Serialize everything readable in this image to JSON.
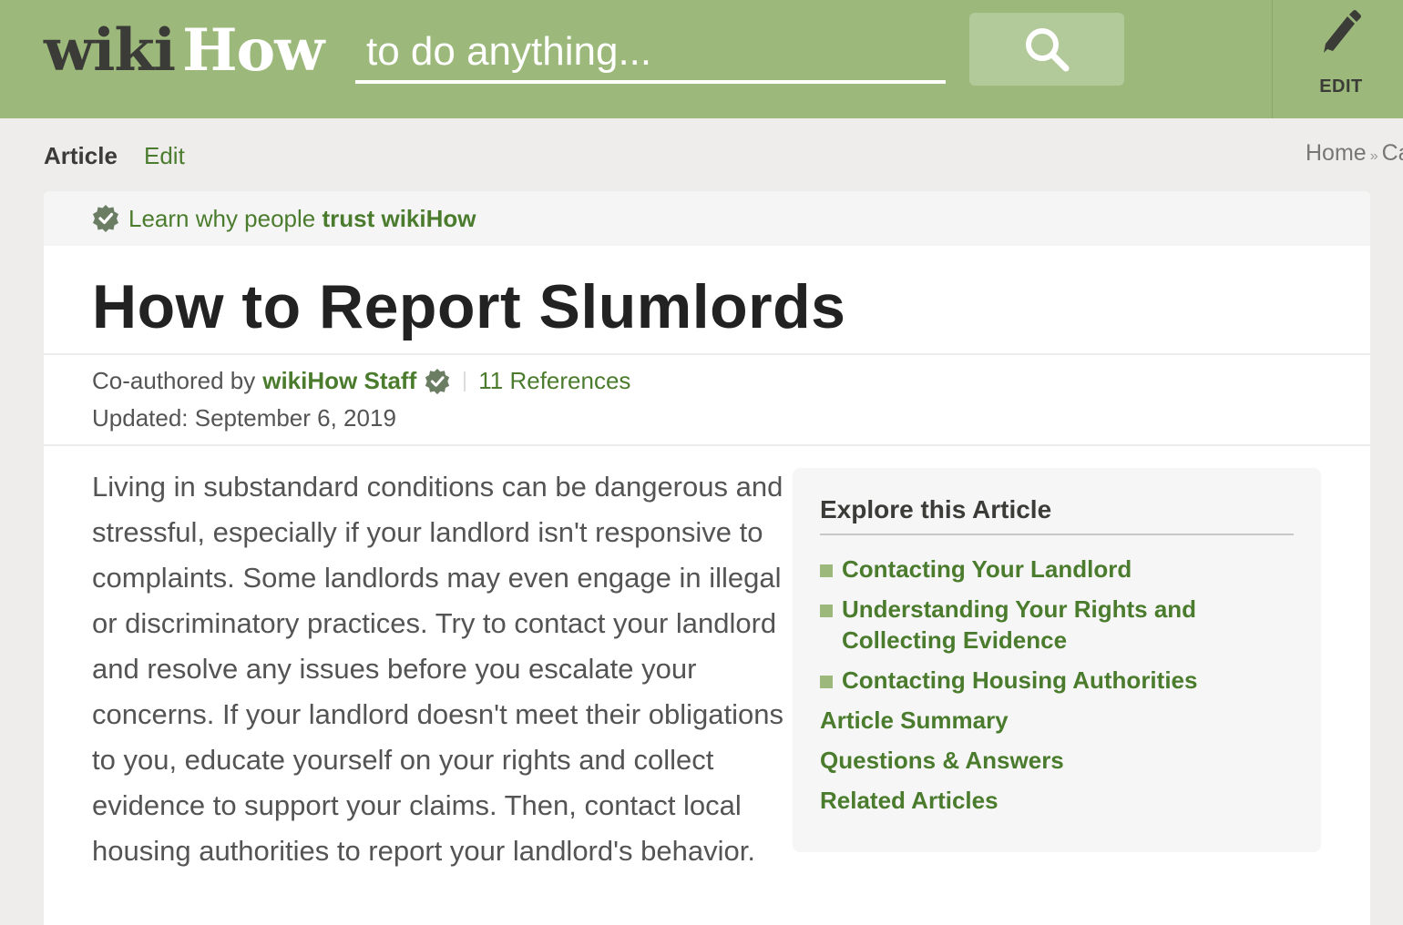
{
  "header": {
    "logo_wiki": "wiki",
    "logo_how": "How",
    "search_placeholder": "to do anything...",
    "edit_label": "EDIT"
  },
  "tabs": {
    "article": "Article",
    "edit": "Edit"
  },
  "breadcrumb": {
    "home": "Home",
    "separator": "»",
    "next": "Ca"
  },
  "trust": {
    "prefix": "Learn why people ",
    "bold": "trust wikiHow"
  },
  "article": {
    "title": "How to Report Slumlords",
    "coauthor_prefix": "Co-authored by",
    "author": "wikiHow Staff",
    "references": "11 References",
    "updated": "Updated: September 6, 2019",
    "intro": "Living in substandard conditions can be dangerous and stressful, especially if your landlord isn't responsive to complaints. Some landlords may even engage in illegal or discriminatory practices. Try to contact your landlord and resolve any issues before you escalate your concerns. If your landlord doesn't meet their obligations to you, educate yourself on your rights and collect evidence to support your claims. Then, contact local housing authorities to report your landlord's behavior."
  },
  "toc": {
    "title": "Explore this Article",
    "sections": [
      "Contacting Your Landlord",
      "Understanding Your Rights and Collecting Evidence",
      "Contacting Housing Authorities"
    ],
    "links": [
      "Article Summary",
      "Questions & Answers",
      "Related Articles"
    ]
  },
  "colors": {
    "header_bg": "#9cb97b",
    "accent_green": "#4b7c2e",
    "page_bg": "#eeedeb"
  }
}
